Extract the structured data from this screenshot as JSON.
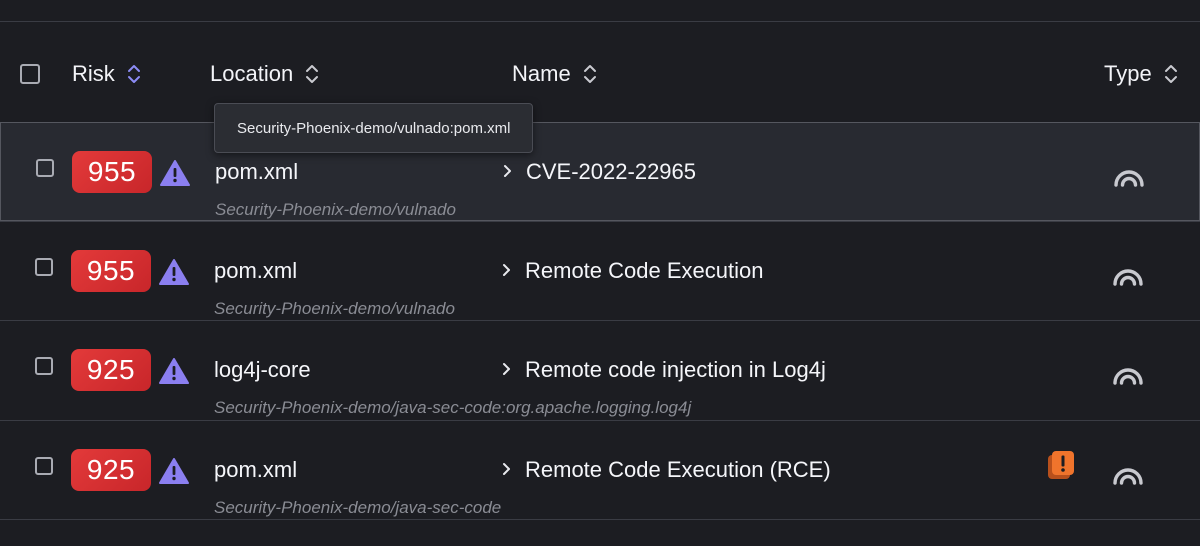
{
  "header": {
    "risk_label": "Risk",
    "location_label": "Location",
    "name_label": "Name",
    "type_label": "Type"
  },
  "tooltip": {
    "text": "Security-Phoenix-demo/vulnado:pom.xml"
  },
  "rows": [
    {
      "risk": "955",
      "location": "pom.xml",
      "path": "Security-Phoenix-demo/vulnado",
      "name": "CVE-2022-22965"
    },
    {
      "risk": "955",
      "location": "pom.xml",
      "path": "Security-Phoenix-demo/vulnado",
      "name": "Remote Code Execution"
    },
    {
      "risk": "925",
      "location": "log4j-core",
      "path": "Security-Phoenix-demo/java-sec-code:org.apache.logging.log4j",
      "name": "Remote code injection in Log4j"
    },
    {
      "risk": "925",
      "location": "pom.xml",
      "path": "Security-Phoenix-demo/java-sec-code",
      "name": "Remote Code Execution (RCE)"
    }
  ],
  "icons": {
    "risk_sort": "sort-icon-active",
    "sort": "sort-icon",
    "warning": "warning-triangle-icon",
    "chevron": "chevron-right-icon",
    "type": "signal-arc-icon",
    "alert": "alert-square-icon"
  },
  "colors": {
    "background": "#1c1d22",
    "selected_row": "#282a31",
    "risk_badge": "#d9302f",
    "warning": "#8b7ff0",
    "sort_active": "#8c8cf5",
    "alert": "#f0742c"
  }
}
